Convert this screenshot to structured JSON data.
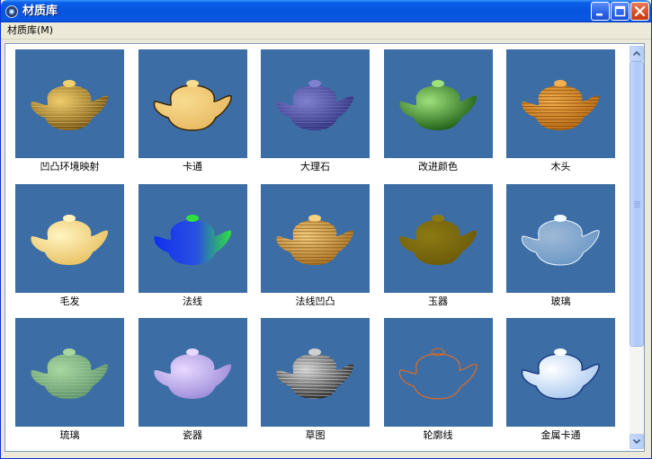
{
  "window": {
    "title": "材质库",
    "icon": "gear-app-icon"
  },
  "titlebar_buttons": [
    "minimize-icon",
    "maximize-icon",
    "close-icon"
  ],
  "menu": {
    "items": [
      {
        "label": "材质库(M)"
      }
    ]
  },
  "materials": [
    {
      "label": "凹凸环境映射",
      "icon": "teapot-bump-env-icon"
    },
    {
      "label": "卡通",
      "icon": "teapot-cartoon-icon"
    },
    {
      "label": "大理石",
      "icon": "teapot-marble-icon"
    },
    {
      "label": "改进颜色",
      "icon": "teapot-improved-color-icon"
    },
    {
      "label": "木头",
      "icon": "teapot-wood-icon"
    },
    {
      "label": "毛发",
      "icon": "teapot-fur-icon"
    },
    {
      "label": "法线",
      "icon": "teapot-normal-icon"
    },
    {
      "label": "法线凹凸",
      "icon": "teapot-normal-bump-icon"
    },
    {
      "label": "玉器",
      "icon": "teapot-jade-icon"
    },
    {
      "label": "玻璃",
      "icon": "teapot-glass-icon"
    },
    {
      "label": "琉璃",
      "icon": "teapot-colored-glaze-icon"
    },
    {
      "label": "瓷器",
      "icon": "teapot-porcelain-icon"
    },
    {
      "label": "草图",
      "icon": "teapot-sketch-icon"
    },
    {
      "label": "轮廓线",
      "icon": "teapot-outline-icon"
    },
    {
      "label": "金属卡通",
      "icon": "teapot-metal-cartoon-icon"
    }
  ],
  "colors": {
    "tile_background": "#3c6ea5",
    "titlebar": "#0653de",
    "list_background": "#ffffff"
  }
}
